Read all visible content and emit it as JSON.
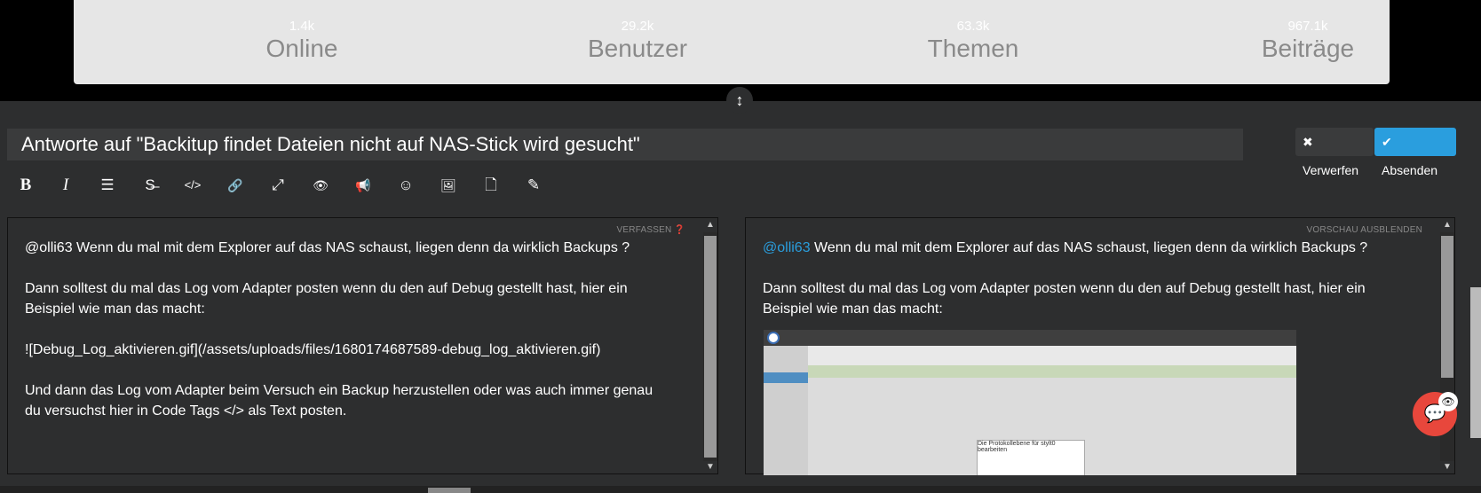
{
  "stats": [
    {
      "value": "1.4k",
      "label": "Online"
    },
    {
      "value": "29.2k",
      "label": "Benutzer"
    },
    {
      "value": "63.3k",
      "label": "Themen"
    },
    {
      "value": "967.1k",
      "label": "Beiträge"
    }
  ],
  "composer": {
    "title": "Antworte auf \"Backitup findet Dateien nicht auf NAS-Stick wird gesucht\"",
    "discard_label": "Verwerfen",
    "submit_label": "Absenden",
    "toolbar": [
      {
        "icon": "bold-icon",
        "glyph": "B"
      },
      {
        "icon": "italic-icon",
        "glyph": "I"
      },
      {
        "icon": "list-icon",
        "glyph": "☰"
      },
      {
        "icon": "strikethrough-icon",
        "glyph": "S̶"
      },
      {
        "icon": "code-icon",
        "glyph": "</>"
      },
      {
        "icon": "link-icon",
        "glyph": "🔗"
      },
      {
        "icon": "fullscreen-icon",
        "glyph": "⤢"
      },
      {
        "icon": "eye-icon",
        "glyph": "👁"
      },
      {
        "icon": "megaphone-icon",
        "glyph": "📢"
      },
      {
        "icon": "emoji-icon",
        "glyph": "☺"
      },
      {
        "icon": "image-upload-icon",
        "glyph": "🖼"
      },
      {
        "icon": "file-upload-icon",
        "glyph": "🗋"
      },
      {
        "icon": "eyedropper-icon",
        "glyph": "✎"
      }
    ],
    "write_header": "VERFASSEN ❓",
    "preview_header": "VORSCHAU AUSBLENDEN",
    "write_text": [
      "@olli63 Wenn du mal mit dem Explorer auf das NAS schaust, liegen denn da wirklich Backups ?",
      "Dann solltest du mal das Log vom Adapter posten wenn du den auf Debug gestellt hast, hier ein Beispiel wie man das macht:",
      "![Debug_Log_aktivieren.gif](/assets/uploads/files/1680174687589-debug_log_aktivieren.gif)",
      "Und dann das Log vom Adapter beim Versuch ein Backup herzustellen oder was auch immer genau du versuchst hier in Code Tags </> als Text posten."
    ],
    "preview": {
      "mention": "@olli63",
      "line1_rest": " Wenn du mal mit dem Explorer auf das NAS schaust, liegen denn da wirklich Backups ?",
      "line2": "Dann solltest du mal das Log vom Adapter posten wenn du den auf Debug gestellt hast, hier ein Beispiel wie man das macht:",
      "image_dialog_text": "Die Protokollebene für stylt0 bearbeiten"
    }
  },
  "colors": {
    "accent": "#2a9ede",
    "fab": "#e8473c",
    "composer_bg": "#2d2e2f"
  }
}
